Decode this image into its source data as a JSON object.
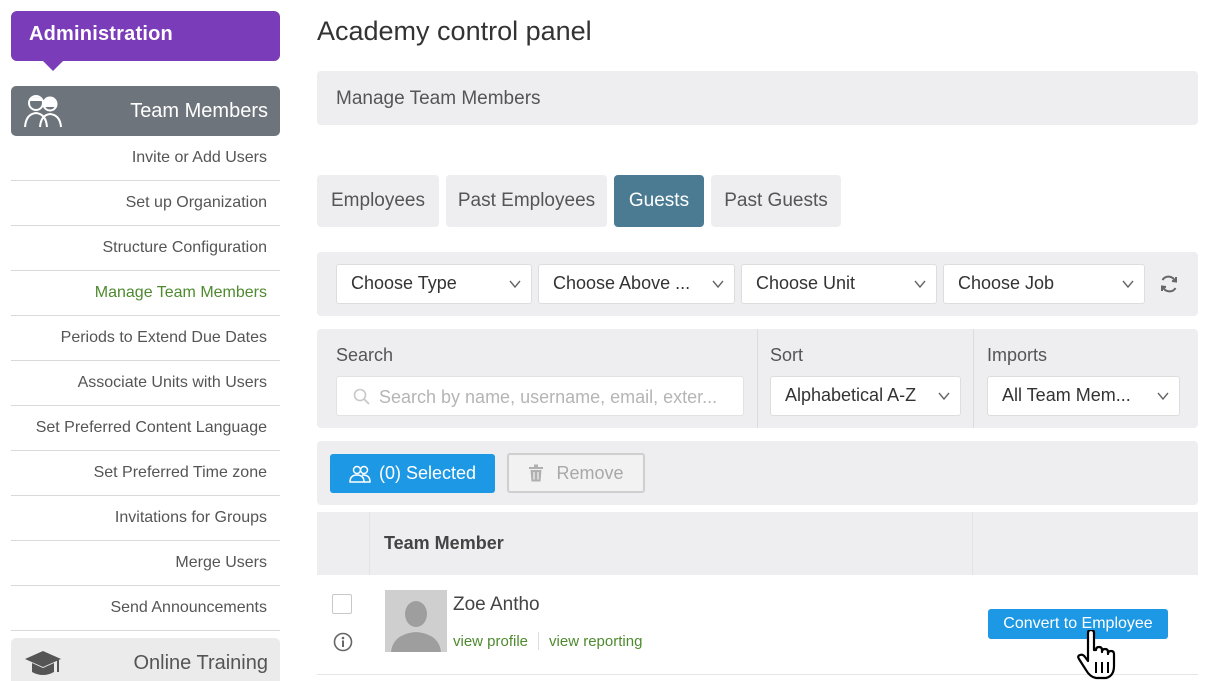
{
  "sidebar": {
    "admin_title": "Administration",
    "section_title": "Team Members",
    "section_icon": "team-members-icon",
    "items": [
      {
        "label": "Invite or Add Users"
      },
      {
        "label": "Set up Organization"
      },
      {
        "label": "Structure Configuration"
      },
      {
        "label": "Manage Team Members",
        "active": true
      },
      {
        "label": "Periods to Extend Due Dates"
      },
      {
        "label": "Associate Units with Users"
      },
      {
        "label": "Set Preferred Content Language"
      },
      {
        "label": "Set Preferred Time zone"
      },
      {
        "label": "Invitations for Groups"
      },
      {
        "label": "Merge Users"
      },
      {
        "label": "Send Announcements"
      }
    ],
    "next_section_title": "Online Training",
    "next_section_icon": "graduation-cap-icon"
  },
  "main": {
    "page_title": "Academy control panel",
    "subheader": "Manage Team Members",
    "tabs": [
      {
        "label": "Employees"
      },
      {
        "label": "Past Employees"
      },
      {
        "label": "Guests",
        "active": true
      },
      {
        "label": "Past Guests"
      }
    ],
    "filters": [
      {
        "value": "Choose Type"
      },
      {
        "value": "Choose Above ..."
      },
      {
        "value": "Choose Unit"
      },
      {
        "value": "Choose Job"
      }
    ],
    "search": {
      "label": "Search",
      "placeholder": "Search by name, username, email, exter..."
    },
    "sort": {
      "label": "Sort",
      "value": "Alphabetical A-Z"
    },
    "imports": {
      "label": "Imports",
      "value": "All Team Mem..."
    },
    "actions": {
      "selected_label": "(0) Selected",
      "remove_label": "Remove"
    },
    "table": {
      "column_header": "Team Member",
      "rows": [
        {
          "name": "Zoe Antho",
          "view_profile": "view profile",
          "view_reporting": "view reporting",
          "convert_label": "Convert to Employee"
        }
      ]
    }
  },
  "colors": {
    "admin_purple": "#7a3cb8",
    "active_tab": "#4b7b92",
    "primary_blue": "#1d98e4",
    "link_green": "#4e8a2e"
  }
}
